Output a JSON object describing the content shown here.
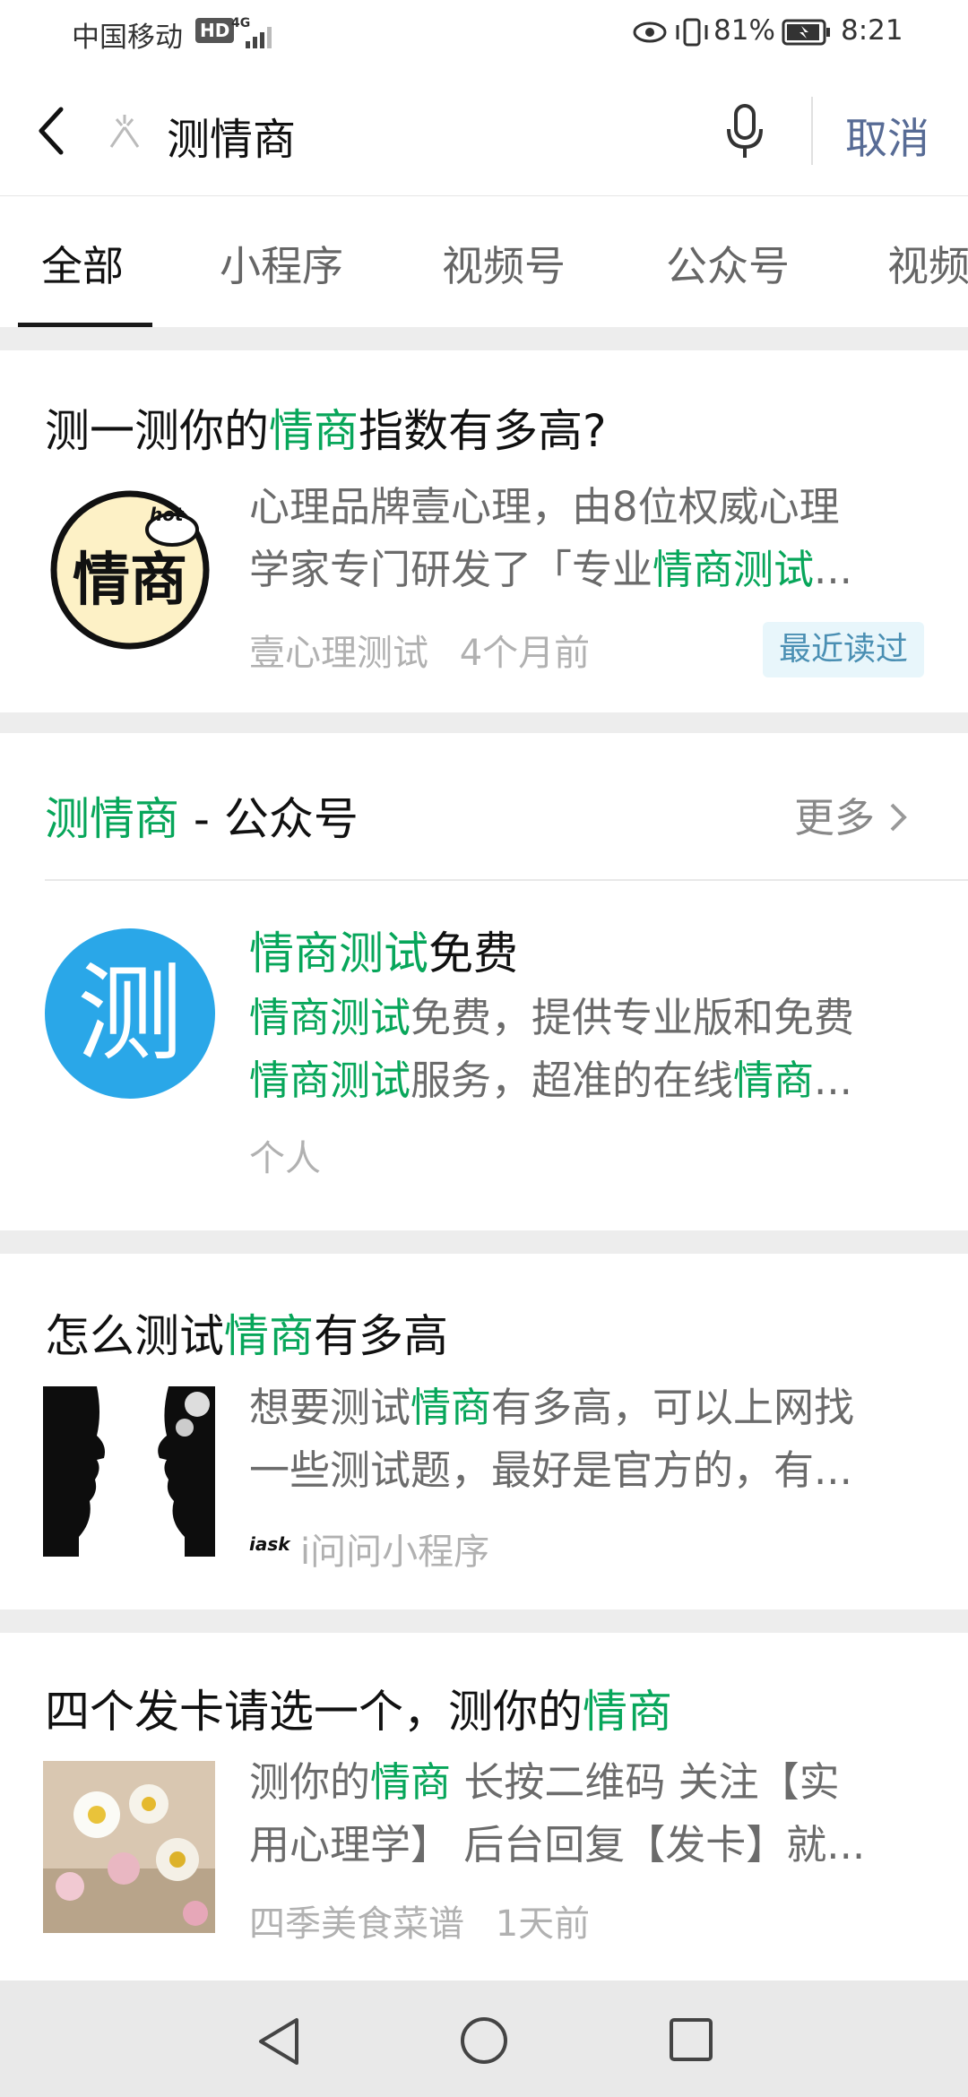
{
  "status_bar": {
    "carrier": "中国移动",
    "hd": "HD",
    "network": "4G",
    "battery_percent": "81%",
    "time": "8:21"
  },
  "search": {
    "query": "测情商",
    "cancel_label": "取消"
  },
  "tabs": [
    {
      "label": "全部",
      "active": true
    },
    {
      "label": "小程序",
      "active": false
    },
    {
      "label": "视频号",
      "active": false
    },
    {
      "label": "公众号",
      "active": false
    },
    {
      "label": "视频",
      "active": false
    }
  ],
  "results": {
    "article1": {
      "title_pre": "测一测你的",
      "title_hl": "情商",
      "title_post": "指数有多高?",
      "thumb_text": "情商",
      "thumb_badge": "hot",
      "snippet_line1": "心理品牌壹心理，由8位权威心理",
      "snippet_line2_pre": "学家专门研发了「专业",
      "snippet_line2_hl": "情商测试",
      "snippet_line2_post": "...",
      "source": "壹心理测试",
      "time": "4个月前",
      "badge": "最近读过"
    },
    "account_section": {
      "header_hl": "测情商",
      "header_post": " - 公众号",
      "more_label": "更多",
      "avatar_text": "测",
      "name_hl": "情商测试",
      "name_post": "免费",
      "desc_line1_hl": "情商测试",
      "desc_line1_post": "免费，提供专业版和免费",
      "desc_line2_hl": "情商测试",
      "desc_line2_mid": "服务，超准的在线",
      "desc_line2_hl2": "情商",
      "desc_line2_post": "...",
      "type": "个人"
    },
    "article2": {
      "title_pre": "怎么测试",
      "title_hl": "情商",
      "title_post": "有多高",
      "snippet_line1_pre": "想要测试",
      "snippet_line1_hl": "情商",
      "snippet_line1_post": "有多高，可以上网找",
      "snippet_line2": "一些测试题，最好是官方的，有...",
      "source_logo": "iask",
      "source": "i问问小程序"
    },
    "article3": {
      "title_pre": "四个发卡请选一个，测你的",
      "title_hl": "情商",
      "snippet_line1_pre": "测你的",
      "snippet_line1_hl": "情商",
      "snippet_line1_post": " 长按二维码 关注【实",
      "snippet_line2": "用心理学】 后台回复【发卡】就...",
      "source": "四季美食菜谱",
      "time": "1天前"
    }
  },
  "colors": {
    "highlight": "#07a65a",
    "link_blue": "#576b95",
    "avatar_blue": "#2aa7e8"
  }
}
